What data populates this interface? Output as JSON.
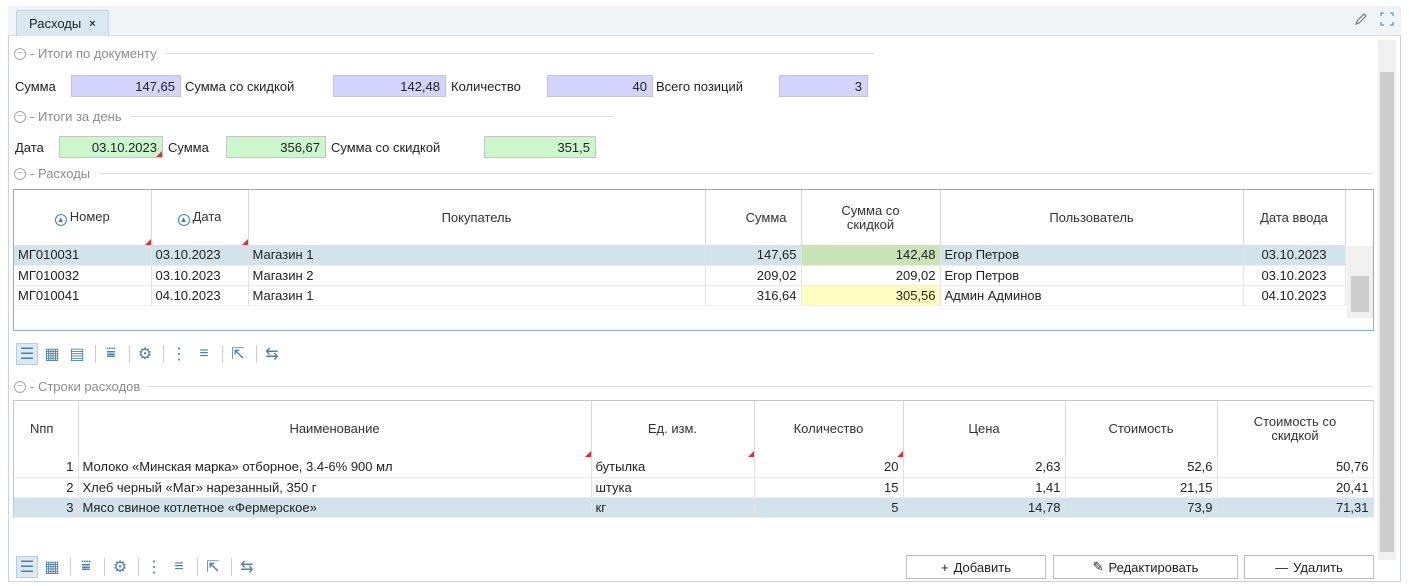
{
  "tab": {
    "title": "Расходы",
    "close": "×"
  },
  "icons": {
    "edit": "pencil-icon",
    "fullscreen": "expand-icon"
  },
  "sections": {
    "doc_totals": "Итоги по документу",
    "day_totals": "Итоги за день",
    "expenses": "Расходы",
    "expense_rows": "Строки расходов"
  },
  "doc_totals": {
    "sum_label": "Сумма",
    "sum_value": "147,65",
    "disc_label": "Сумма со скидкой",
    "disc_value": "142,48",
    "qty_label": "Количество",
    "qty_value": "40",
    "pos_label": "Всего позиций",
    "pos_value": "3"
  },
  "day_totals": {
    "date_label": "Дата",
    "date_value": "03.10.2023",
    "sum_label": "Сумма",
    "sum_value": "356,67",
    "disc_label": "Сумма со скидкой",
    "disc_value": "351,5"
  },
  "expenses_table": {
    "headers": [
      "Номер",
      "Дата",
      "Покупатель",
      "Сумма",
      "Сумма со скидкой",
      "Пользователь",
      "Дата ввода"
    ],
    "rows": [
      [
        "МГ010031",
        "03.10.2023",
        "Магазин 1",
        "147,65",
        "142,48",
        "Егор Петров",
        "03.10.2023"
      ],
      [
        "МГ010032",
        "03.10.2023",
        "Магазин 2",
        "209,02",
        "209,02",
        "Егор Петров",
        "03.10.2023"
      ],
      [
        "МГ010041",
        "04.10.2023",
        "Магазин 1",
        "316,64",
        "305,56",
        "Админ Админов",
        "04.10.2023"
      ]
    ]
  },
  "lines_table": {
    "headers": [
      "Nпп",
      "Наименование",
      "Ед. изм.",
      "Количество",
      "Цена",
      "Стоимость",
      "Стоимость со скидкой"
    ],
    "rows": [
      [
        "1",
        "Молоко «Минская марка» отборное, 3.4-6% 900 мл",
        "бутылка",
        "20",
        "2,63",
        "52,6",
        "50,76"
      ],
      [
        "2",
        "Хлеб черный «Маг» нарезанный, 350 г",
        "штука",
        "15",
        "1,41",
        "21,15",
        "20,41"
      ],
      [
        "3",
        "Мясо свиное котлетное «Фермерское»",
        "кг",
        "5",
        "14,78",
        "73,9",
        "71,31"
      ]
    ]
  },
  "toolbar_icons": [
    "list-view-icon",
    "grid-view-icon",
    "calendar-view-icon",
    "filter-icon",
    "settings-icon",
    "numbered-list-icon",
    "add-row-icon",
    "export-icon",
    "refresh-icon"
  ],
  "buttons": {
    "add": "Добавить",
    "edit": "Редактировать",
    "delete": "Удалить"
  }
}
